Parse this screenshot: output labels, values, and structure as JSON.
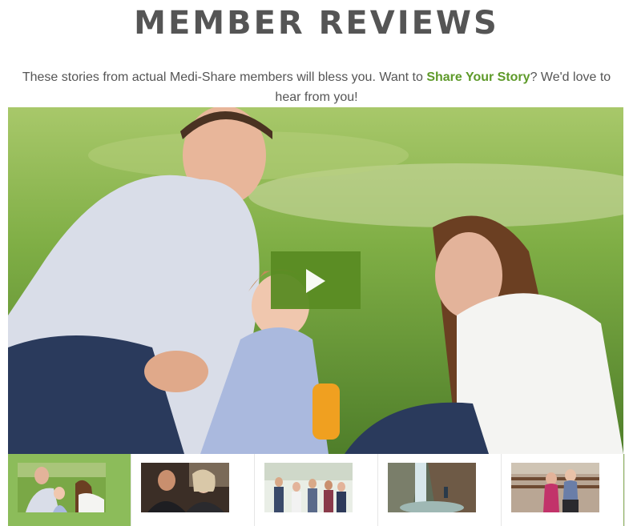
{
  "page": {
    "title": "MEMBER REVIEWS",
    "intro_before": "These stories from actual Medi-Share members will bless you. Want to ",
    "intro_link": "Share Your Story",
    "intro_after": "? We'd love to hear from you!"
  },
  "video": {
    "play_icon": "play-icon",
    "accent_color": "#5a8c23"
  },
  "thumbnails": {
    "active_index": 0,
    "count": 5,
    "active_color": "#8cbc5a"
  }
}
